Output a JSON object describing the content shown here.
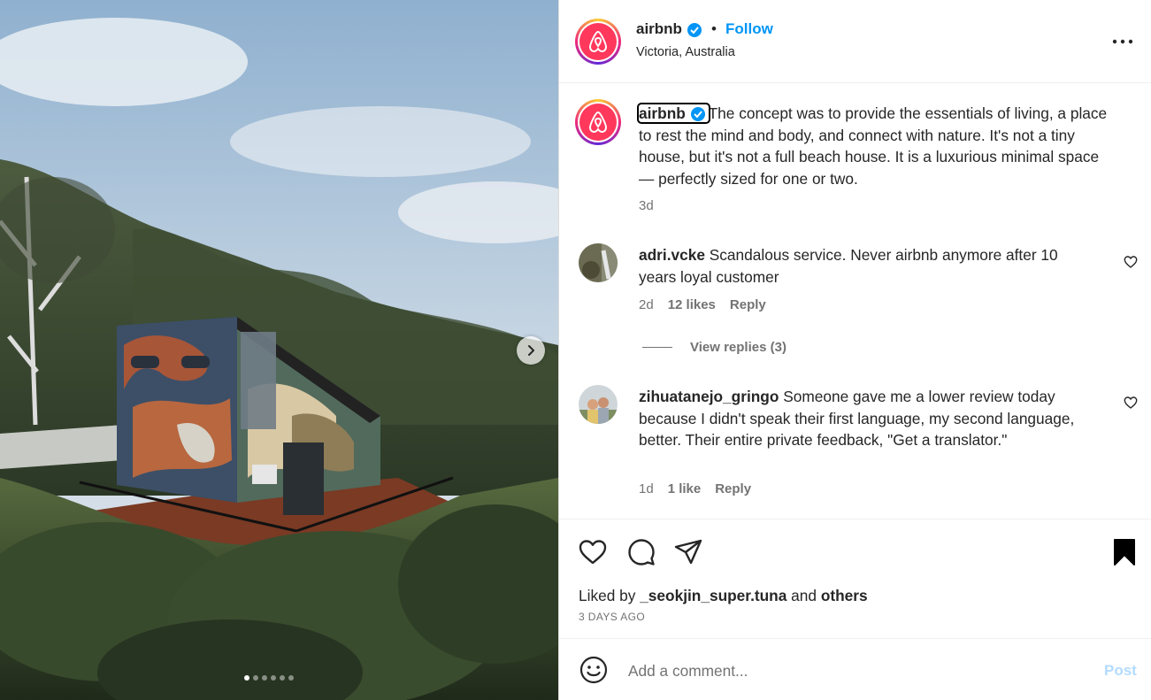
{
  "post": {
    "username": "airbnb",
    "location": "Victoria, Australia",
    "follow_label": "Follow",
    "separator": "•",
    "verified_icon": "verified-badge-icon",
    "more_icon": "more-options-icon"
  },
  "caption": {
    "username": "airbnb",
    "text": "The concept was to provide the essentials of living, a place to rest the mind and body, and connect with nature. It's not a tiny house, but it's not a full beach house. It is a luxurious minimal space — perfectly sized for one or two.",
    "time": "3d"
  },
  "comments": [
    {
      "username": "adri.vcke",
      "text": "Scandalous service. Never airbnb anymore after 10 years loyal customer",
      "time": "2d",
      "likes": "12 likes",
      "reply_label": "Reply",
      "view_replies": "View replies (3)"
    },
    {
      "username": "zihuatanejo_gringo",
      "text": "Someone gave me a lower review today because I didn't speak their first language, my second language, better. Their entire private feedback, \"Get a translator.\"",
      "time": "1d",
      "likes": "1 like",
      "reply_label": "Reply"
    }
  ],
  "actions": {
    "icons": [
      "heart-icon",
      "comment-icon",
      "share-icon",
      "bookmark-icon"
    ],
    "liked_by_prefix": "Liked by",
    "liked_by_user": "_seokjin_super.tuna",
    "liked_by_and": "and",
    "liked_by_others": "others",
    "post_date": "3 DAYS AGO"
  },
  "composer": {
    "placeholder": "Add a comment...",
    "post_label": "Post"
  },
  "carousel": {
    "slide_count": 6,
    "active_index": 0
  },
  "colors": {
    "accent": "#0095f6",
    "brand": "#ff385c",
    "muted": "#737373",
    "post_disabled": "#b3dbff"
  }
}
